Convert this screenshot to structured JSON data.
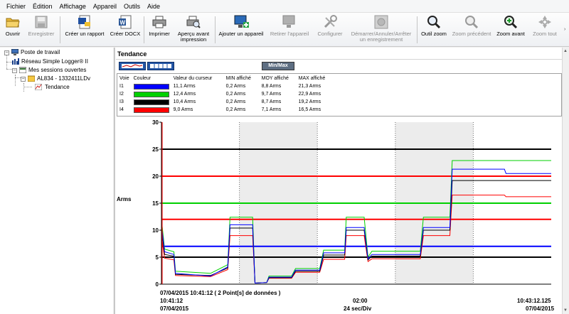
{
  "menu": [
    "Fichier",
    "Édition",
    "Affichage",
    "Appareil",
    "Outils",
    "Aide"
  ],
  "toolbar": {
    "open": "Ouvrir",
    "save": "Enregistrer",
    "create_report": "Créer un rapport",
    "create_docx": "Créer DOCX",
    "print": "Imprimer",
    "print_preview_1": "Aperçu avant",
    "print_preview_2": "impression",
    "add_device": "Ajouter un appareil",
    "remove_device": "Retirer l'appareil",
    "configure": "Configurer",
    "start_stop_1": "Démarrer/Annuler/Arrêter",
    "start_stop_2": "un enregistrement",
    "zoom_tool": "Outil zoom",
    "zoom_previous": "Zoom précédent",
    "zoom_in": "Zoom avant",
    "zoom_all": "Zoom tout"
  },
  "tree": {
    "root": "Poste de travail",
    "network": "Réseau Simple Logger® II",
    "sessions": "Mes sessions ouvertes",
    "device": "AL834 - 1332411LDv",
    "trend": "Tendance"
  },
  "panel": {
    "title": "Tendance",
    "minmax": "Min/Max"
  },
  "legend": {
    "headers": [
      "Voie",
      "Couleur",
      "Valeur du curseur",
      "MIN affiché",
      "MOY affiché",
      "MAX affiché"
    ],
    "rows": [
      {
        "channel": "I1",
        "color": "#0000ff",
        "cursor": "11,1 Arms",
        "min": "0,2 Arms",
        "avg": "8,8 Arms",
        "max": "21,3 Arms"
      },
      {
        "channel": "I2",
        "color": "#00d000",
        "cursor": "12,4 Arms",
        "min": "0,2 Arms",
        "avg": "9,7 Arms",
        "max": "22,9 Arms"
      },
      {
        "channel": "I3",
        "color": "#000000",
        "cursor": "10,4 Arms",
        "min": "0,2 Arms",
        "avg": "8,7 Arms",
        "max": "19,2 Arms"
      },
      {
        "channel": "I4",
        "color": "#ff0000",
        "cursor": "9,0 Arms",
        "min": "0,2 Arms",
        "avg": "7,1 Arms",
        "max": "16,5 Arms"
      }
    ]
  },
  "chart_data": {
    "type": "line",
    "ylabel": "Arms",
    "ylim": [
      0,
      30
    ],
    "yticks": [
      "0",
      "5",
      "10",
      "15",
      "20",
      "25",
      "30"
    ],
    "x_range": [
      "10:41:12",
      "10:43:12.125"
    ],
    "x_divisions": 5,
    "reference_lines": [
      {
        "value": 25,
        "color": "#000000"
      },
      {
        "value": 20,
        "color": "#ff0000"
      },
      {
        "value": 15,
        "color": "#00d000"
      },
      {
        "value": 12,
        "color": "#ff0000"
      },
      {
        "value": 7,
        "color": "#0000ff"
      },
      {
        "value": 5,
        "color": "#000000"
      }
    ],
    "series": [
      {
        "name": "I1",
        "color": "#0000ff",
        "points": [
          [
            0,
            11
          ],
          [
            0.04,
            6
          ],
          [
            0.16,
            5.5
          ],
          [
            0.18,
            2
          ],
          [
            0.63,
            1.5
          ],
          [
            0.85,
            3.2
          ],
          [
            0.88,
            11
          ],
          [
            1.17,
            11
          ],
          [
            1.2,
            0.2
          ],
          [
            1.35,
            0.3
          ],
          [
            1.38,
            1.3
          ],
          [
            1.67,
            1.3
          ],
          [
            1.72,
            2.6
          ],
          [
            2.03,
            2.6
          ],
          [
            2.08,
            5.8
          ],
          [
            2.35,
            5.8
          ],
          [
            2.37,
            10.5
          ],
          [
            2.6,
            10.5
          ],
          [
            2.65,
            4.7
          ],
          [
            2.7,
            5.5
          ],
          [
            3.32,
            5.5
          ],
          [
            3.36,
            10.5
          ],
          [
            3.7,
            10.5
          ],
          [
            3.73,
            21.3
          ],
          [
            4.4,
            21.3
          ],
          [
            4.42,
            20.5
          ],
          [
            5.0,
            20.5
          ]
        ]
      },
      {
        "name": "I2",
        "color": "#00d000",
        "points": [
          [
            0,
            12
          ],
          [
            0.04,
            6.5
          ],
          [
            0.16,
            6
          ],
          [
            0.18,
            2.4
          ],
          [
            0.63,
            2
          ],
          [
            0.85,
            3.6
          ],
          [
            0.88,
            12.4
          ],
          [
            1.17,
            12.4
          ],
          [
            1.2,
            0.2
          ],
          [
            1.35,
            0.3
          ],
          [
            1.38,
            1.5
          ],
          [
            1.67,
            1.5
          ],
          [
            1.72,
            2.9
          ],
          [
            2.03,
            2.9
          ],
          [
            2.08,
            6.3
          ],
          [
            2.35,
            6.3
          ],
          [
            2.37,
            12.4
          ],
          [
            2.6,
            12.4
          ],
          [
            2.65,
            5.0
          ],
          [
            2.7,
            6.1
          ],
          [
            3.32,
            6.1
          ],
          [
            3.36,
            12.4
          ],
          [
            3.7,
            12.4
          ],
          [
            3.73,
            22.9
          ],
          [
            5.0,
            22.9
          ]
        ]
      },
      {
        "name": "I3",
        "color": "#000000",
        "points": [
          [
            0,
            10.4
          ],
          [
            0.04,
            5.5
          ],
          [
            0.16,
            5.2
          ],
          [
            0.18,
            1.8
          ],
          [
            0.63,
            1.6
          ],
          [
            0.85,
            3.0
          ],
          [
            0.88,
            10.4
          ],
          [
            1.17,
            10.4
          ],
          [
            1.2,
            0.2
          ],
          [
            1.35,
            0.3
          ],
          [
            1.38,
            1.2
          ],
          [
            1.67,
            1.2
          ],
          [
            1.72,
            2.4
          ],
          [
            2.03,
            2.4
          ],
          [
            2.08,
            5.4
          ],
          [
            2.35,
            5.4
          ],
          [
            2.37,
            10.0
          ],
          [
            2.6,
            10.0
          ],
          [
            2.65,
            4.5
          ],
          [
            2.7,
            5.2
          ],
          [
            3.32,
            5.2
          ],
          [
            3.36,
            10.0
          ],
          [
            3.7,
            10.0
          ],
          [
            3.73,
            19.2
          ],
          [
            5.0,
            19.2
          ]
        ]
      },
      {
        "name": "I4",
        "color": "#ff0000",
        "points": [
          [
            0,
            9
          ],
          [
            0.04,
            4.8
          ],
          [
            0.16,
            4.5
          ],
          [
            0.18,
            1.6
          ],
          [
            0.63,
            1.4
          ],
          [
            0.85,
            2.7
          ],
          [
            0.88,
            9.0
          ],
          [
            1.17,
            9.0
          ],
          [
            1.2,
            0.2
          ],
          [
            1.35,
            0.3
          ],
          [
            1.38,
            1.1
          ],
          [
            1.67,
            1.1
          ],
          [
            1.72,
            2.2
          ],
          [
            2.03,
            2.2
          ],
          [
            2.08,
            4.6
          ],
          [
            2.35,
            4.6
          ],
          [
            2.37,
            9.0
          ],
          [
            2.6,
            9.0
          ],
          [
            2.65,
            4.2
          ],
          [
            2.7,
            4.7
          ],
          [
            3.32,
            4.7
          ],
          [
            3.36,
            9.0
          ],
          [
            3.7,
            9.0
          ],
          [
            3.73,
            16.5
          ],
          [
            4.4,
            16.5
          ],
          [
            4.42,
            16.2
          ],
          [
            5.0,
            16.2
          ]
        ]
      }
    ]
  },
  "xaxis": {
    "cursor_info": "07/04/2015 10:41:12 ( 2 Point[s] de données )",
    "start_time": "10:41:12",
    "start_date": "07/04/2015",
    "mid_time": "02:00",
    "mid_div": "24 sec/Div",
    "end_time": "10:43:12.125",
    "end_date": "07/04/2015"
  }
}
